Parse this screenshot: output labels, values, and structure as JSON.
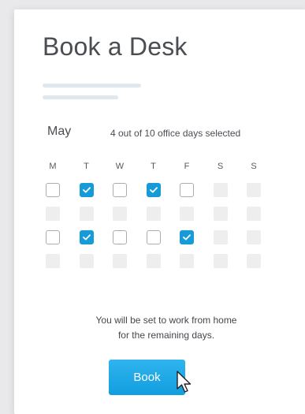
{
  "page": {
    "title": "Book a Desk"
  },
  "calendar": {
    "month": "May",
    "summary": "4 out of 10 office days selected",
    "weekdays": [
      "M",
      "T",
      "W",
      "T",
      "F",
      "S",
      "S"
    ],
    "rows": [
      [
        "empty",
        "checked",
        "empty",
        "checked",
        "empty",
        "filler",
        "filler"
      ],
      [
        "filler",
        "filler",
        "filler",
        "filler",
        "filler",
        "filler",
        "filler"
      ],
      [
        "empty",
        "checked",
        "empty",
        "empty",
        "checked",
        "filler",
        "filler"
      ],
      [
        "filler",
        "filler",
        "filler",
        "filler",
        "filler",
        "filler",
        "filler"
      ]
    ]
  },
  "note": {
    "line1": "You will be set to work from home",
    "line2": "for the remaining days."
  },
  "book_button": {
    "label": "Book"
  },
  "colors": {
    "accent": "#169bd8",
    "placeholder": "#dfe7ef"
  },
  "icons": {
    "checkbox": "check-icon",
    "pointer": "mouse-pointer-icon"
  }
}
